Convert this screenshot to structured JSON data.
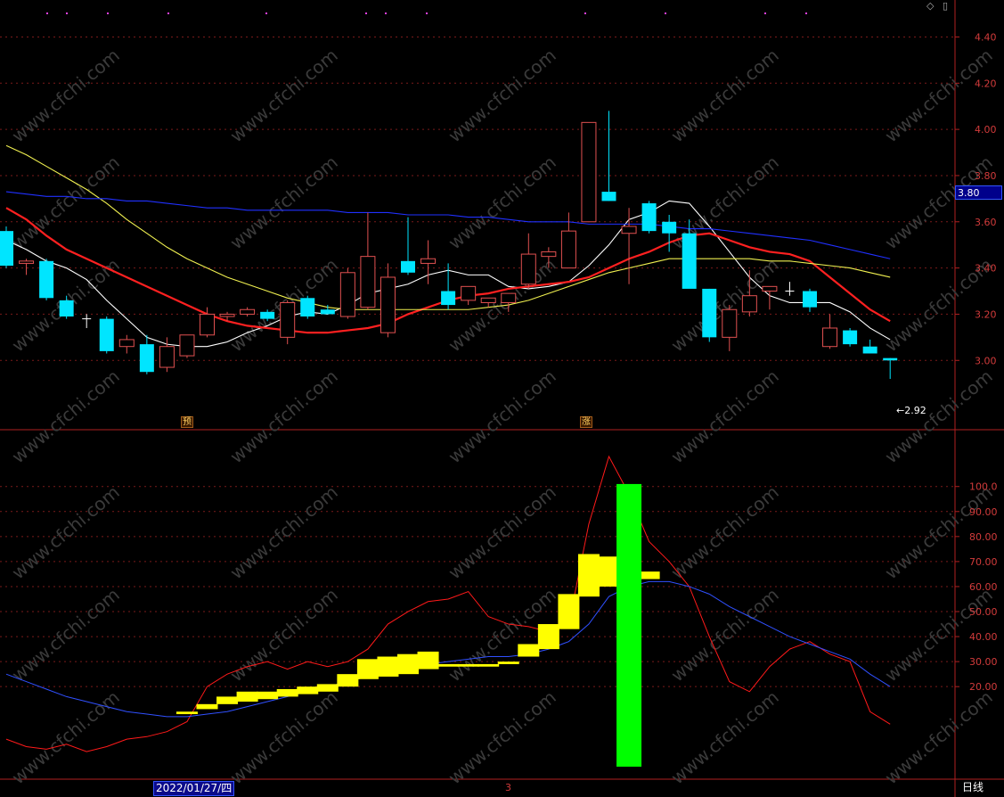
{
  "toolbar": {
    "diamond_icon": "diamond-icon",
    "window_icon": "window-icon"
  },
  "price_tag": "3.80",
  "min_label": "2.92",
  "min_arrow": "←",
  "date_label": "2022/01/27/四",
  "xaxis_mark": "3",
  "period_label": "日线",
  "markers": [
    {
      "text": "预"
    },
    {
      "text": "涨"
    }
  ],
  "watermark": "www.cfchi.com",
  "colors": {
    "up": "#e05050",
    "down": "#00e5ff",
    "ma5": "#ffffff",
    "ma10": "#ff2020",
    "ma20": "#f0f050",
    "ma60": "#2030ff",
    "indicator_red": "#ff1a1a",
    "indicator_blue": "#3050ff",
    "bar_yellow": "#ffff00",
    "bar_green": "#00ff00",
    "grid": "#7a1a1a"
  },
  "price_axis": {
    "ticks": [
      "4.40",
      "4.20",
      "4.00",
      "3.80",
      "3.60",
      "3.40",
      "3.20",
      "3.00"
    ],
    "min": 2.7,
    "max": 4.56
  },
  "indicator_axis": {
    "ticks": [
      "100.0",
      "90.00",
      "80.00",
      "70.00",
      "60.00",
      "50.00",
      "40.00",
      "30.00",
      "20.00"
    ],
    "min": -17,
    "max": 122
  },
  "chart_data": [
    {
      "type": "candlestick",
      "title": "",
      "x_count": 45,
      "ohlc": [
        [
          3.56,
          3.58,
          3.4,
          3.41
        ],
        [
          3.42,
          3.44,
          3.37,
          3.43
        ],
        [
          3.43,
          3.44,
          3.26,
          3.27
        ],
        [
          3.26,
          3.28,
          3.18,
          3.19
        ],
        [
          3.18,
          3.2,
          3.14,
          3.18
        ],
        [
          3.18,
          3.19,
          3.03,
          3.04
        ],
        [
          3.06,
          3.11,
          3.03,
          3.09
        ],
        [
          3.07,
          3.11,
          2.94,
          2.95
        ],
        [
          2.97,
          3.1,
          2.95,
          3.06
        ],
        [
          3.02,
          3.11,
          3.01,
          3.11
        ],
        [
          3.11,
          3.23,
          3.1,
          3.2
        ],
        [
          3.19,
          3.21,
          3.17,
          3.2
        ],
        [
          3.2,
          3.23,
          3.19,
          3.22
        ],
        [
          3.21,
          3.22,
          3.17,
          3.18
        ],
        [
          3.1,
          3.26,
          3.07,
          3.25
        ],
        [
          3.27,
          3.28,
          3.18,
          3.19
        ],
        [
          3.22,
          3.24,
          3.2,
          3.2
        ],
        [
          3.19,
          3.4,
          3.18,
          3.38
        ],
        [
          3.23,
          3.64,
          3.22,
          3.45
        ],
        [
          3.12,
          3.42,
          3.1,
          3.36
        ],
        [
          3.43,
          3.62,
          3.37,
          3.38
        ],
        [
          3.42,
          3.52,
          3.33,
          3.44
        ],
        [
          3.3,
          3.42,
          3.22,
          3.24
        ],
        [
          3.26,
          3.31,
          3.24,
          3.32
        ],
        [
          3.25,
          3.27,
          3.23,
          3.27
        ],
        [
          3.25,
          3.28,
          3.21,
          3.29
        ],
        [
          3.33,
          3.55,
          3.31,
          3.46
        ],
        [
          3.45,
          3.49,
          3.4,
          3.47
        ],
        [
          3.4,
          3.64,
          3.4,
          3.56
        ],
        [
          3.6,
          4.03,
          3.6,
          4.03
        ],
        [
          3.73,
          4.08,
          3.69,
          3.69
        ],
        [
          3.55,
          3.66,
          3.33,
          3.58
        ],
        [
          3.68,
          3.69,
          3.55,
          3.56
        ],
        [
          3.6,
          3.63,
          3.47,
          3.55
        ],
        [
          3.55,
          3.61,
          3.32,
          3.31
        ],
        [
          3.31,
          3.31,
          3.08,
          3.1
        ],
        [
          3.1,
          3.24,
          3.04,
          3.22
        ],
        [
          3.21,
          3.39,
          3.19,
          3.28
        ],
        [
          3.3,
          3.32,
          3.22,
          3.32
        ],
        [
          3.3,
          3.34,
          3.28,
          3.3
        ],
        [
          3.3,
          3.31,
          3.21,
          3.23
        ],
        [
          3.06,
          3.2,
          3.05,
          3.14
        ],
        [
          3.13,
          3.14,
          3.06,
          3.07
        ],
        [
          3.06,
          3.09,
          3.03,
          3.03
        ],
        [
          3.01,
          3.01,
          2.92,
          3.0
        ]
      ],
      "series": [
        {
          "name": "",
          "color_key": "ma5",
          "values": [
            3.52,
            3.48,
            3.43,
            3.4,
            3.35,
            3.26,
            3.18,
            3.1,
            3.07,
            3.06,
            3.06,
            3.08,
            3.12,
            3.15,
            3.19,
            3.21,
            3.2,
            3.24,
            3.29,
            3.31,
            3.33,
            3.37,
            3.39,
            3.37,
            3.37,
            3.32,
            3.31,
            3.32,
            3.34,
            3.41,
            3.5,
            3.61,
            3.64,
            3.69,
            3.68,
            3.58,
            3.47,
            3.36,
            3.28,
            3.25,
            3.25,
            3.25,
            3.21,
            3.14,
            3.09
          ]
        },
        {
          "name": "",
          "color_key": "ma10",
          "values": [
            3.66,
            3.61,
            3.54,
            3.48,
            3.44,
            3.4,
            3.36,
            3.32,
            3.28,
            3.24,
            3.2,
            3.17,
            3.15,
            3.14,
            3.13,
            3.12,
            3.12,
            3.13,
            3.14,
            3.16,
            3.2,
            3.23,
            3.26,
            3.28,
            3.29,
            3.31,
            3.32,
            3.33,
            3.34,
            3.36,
            3.4,
            3.44,
            3.47,
            3.51,
            3.54,
            3.55,
            3.52,
            3.49,
            3.47,
            3.46,
            3.43,
            3.36,
            3.29,
            3.22,
            3.17
          ]
        },
        {
          "name": "",
          "color_key": "ma20",
          "values": [
            3.93,
            3.89,
            3.84,
            3.79,
            3.74,
            3.68,
            3.61,
            3.55,
            3.49,
            3.44,
            3.4,
            3.36,
            3.33,
            3.3,
            3.27,
            3.25,
            3.23,
            3.22,
            3.22,
            3.22,
            3.22,
            3.22,
            3.22,
            3.22,
            3.23,
            3.24,
            3.26,
            3.29,
            3.32,
            3.35,
            3.38,
            3.4,
            3.42,
            3.44,
            3.44,
            3.44,
            3.44,
            3.44,
            3.43,
            3.43,
            3.42,
            3.41,
            3.4,
            3.38,
            3.36
          ]
        },
        {
          "name": "",
          "color_key": "ma60",
          "values": [
            3.73,
            3.72,
            3.71,
            3.71,
            3.7,
            3.7,
            3.69,
            3.69,
            3.68,
            3.67,
            3.66,
            3.66,
            3.65,
            3.65,
            3.65,
            3.65,
            3.65,
            3.64,
            3.64,
            3.64,
            3.63,
            3.63,
            3.63,
            3.62,
            3.62,
            3.61,
            3.6,
            3.6,
            3.6,
            3.59,
            3.59,
            3.59,
            3.59,
            3.58,
            3.57,
            3.57,
            3.56,
            3.55,
            3.54,
            3.53,
            3.52,
            3.5,
            3.48,
            3.46,
            3.44
          ]
        }
      ]
    },
    {
      "type": "line",
      "title": "",
      "x_count": 45,
      "series": [
        {
          "name": "",
          "color_key": "indicator_red",
          "values": [
            -1,
            -4,
            -5,
            -3,
            -6,
            -4,
            -1,
            0,
            2,
            6,
            20,
            25,
            28,
            30,
            27,
            30,
            28,
            30,
            35,
            45,
            50,
            54,
            55,
            58,
            48,
            45,
            44,
            42,
            45,
            85,
            112,
            97,
            78,
            70,
            60,
            40,
            22,
            18,
            28,
            35,
            38,
            33,
            30,
            10,
            5
          ]
        },
        {
          "name": "",
          "color_key": "indicator_blue",
          "values": [
            25,
            22,
            19,
            16,
            14,
            12,
            10,
            9,
            8,
            8,
            9,
            10,
            12,
            14,
            16,
            18,
            20,
            22,
            24,
            26,
            28,
            29,
            30,
            31,
            32,
            32,
            33,
            35,
            38,
            45,
            56,
            60,
            62,
            62,
            60,
            57,
            52,
            48,
            44,
            40,
            37,
            34,
            31,
            25,
            20
          ]
        }
      ],
      "bars_yellow": [
        {
          "index": 9,
          "low": 9,
          "high": 10
        },
        {
          "index": 10,
          "low": 11,
          "high": 13
        },
        {
          "index": 11,
          "low": 13,
          "high": 16
        },
        {
          "index": 12,
          "low": 14,
          "high": 18
        },
        {
          "index": 13,
          "low": 15,
          "high": 18
        },
        {
          "index": 14,
          "low": 16,
          "high": 19
        },
        {
          "index": 15,
          "low": 17,
          "high": 20
        },
        {
          "index": 16,
          "low": 18,
          "high": 21
        },
        {
          "index": 17,
          "low": 20,
          "high": 25
        },
        {
          "index": 18,
          "low": 23,
          "high": 31
        },
        {
          "index": 19,
          "low": 24,
          "high": 32
        },
        {
          "index": 20,
          "low": 25,
          "high": 33
        },
        {
          "index": 21,
          "low": 27,
          "high": 34
        },
        {
          "index": 22,
          "low": 28,
          "high": 29
        },
        {
          "index": 23,
          "low": 28,
          "high": 29
        },
        {
          "index": 24,
          "low": 28,
          "high": 29
        },
        {
          "index": 25,
          "low": 29,
          "high": 30
        },
        {
          "index": 26,
          "low": 32,
          "high": 37
        },
        {
          "index": 27,
          "low": 35,
          "high": 45
        },
        {
          "index": 28,
          "low": 43,
          "high": 57
        },
        {
          "index": 29,
          "low": 56,
          "high": 73
        },
        {
          "index": 30,
          "low": 60,
          "high": 72
        },
        {
          "index": 31,
          "low": 63,
          "high": 66
        },
        {
          "index": 32,
          "low": 63,
          "high": 66
        }
      ],
      "bars_green": [
        {
          "index": 31,
          "low": -12,
          "high": 101
        }
      ]
    }
  ]
}
